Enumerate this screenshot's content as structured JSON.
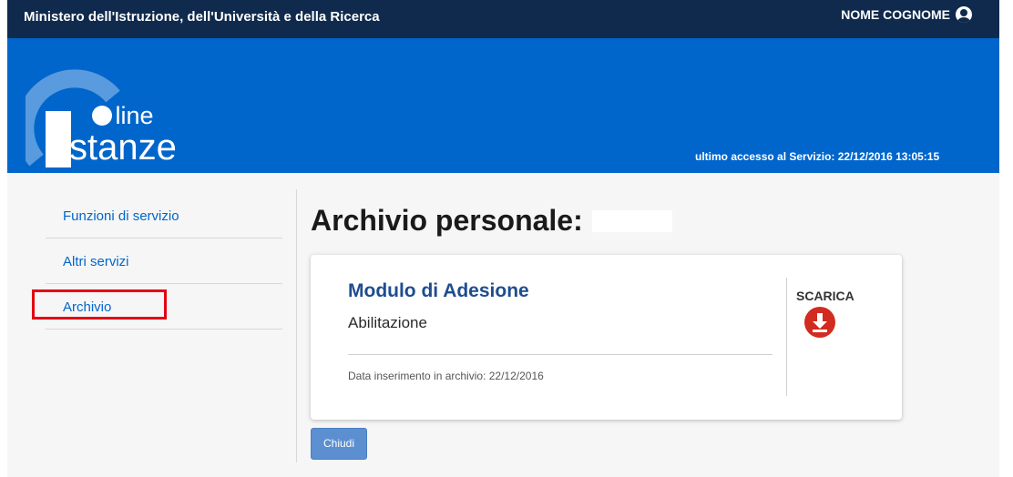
{
  "header": {
    "ministry": "Ministero dell'Istruzione, dell'Università e della Ricerca",
    "user_name": "NOME COGNOME",
    "user_icon": "user-circle-icon"
  },
  "banner": {
    "logo_line1": "n line",
    "logo_line2": "stanze",
    "last_access": "ultimo accesso al Servizio:  22/12/2016 13:05:15"
  },
  "sidebar": {
    "items": [
      {
        "label": "Funzioni di servizio"
      },
      {
        "label": "Altri servizi"
      },
      {
        "label": "Archivio"
      }
    ]
  },
  "main": {
    "title": "Archivio personale:",
    "card": {
      "title": "Modulo di Adesione",
      "subtitle": "Abilitazione",
      "date_label": "Data inserimento in archivio: 22/12/2016",
      "download_label": "SCARICA",
      "download_icon": "download-icon"
    },
    "close_label": "Chiudi"
  },
  "colors": {
    "top_bar": "#0f2a4d",
    "banner": "#0066cc",
    "link": "#0066cc",
    "highlight": "#e30613",
    "download": "#d22b20",
    "button": "#5b8fd0"
  }
}
